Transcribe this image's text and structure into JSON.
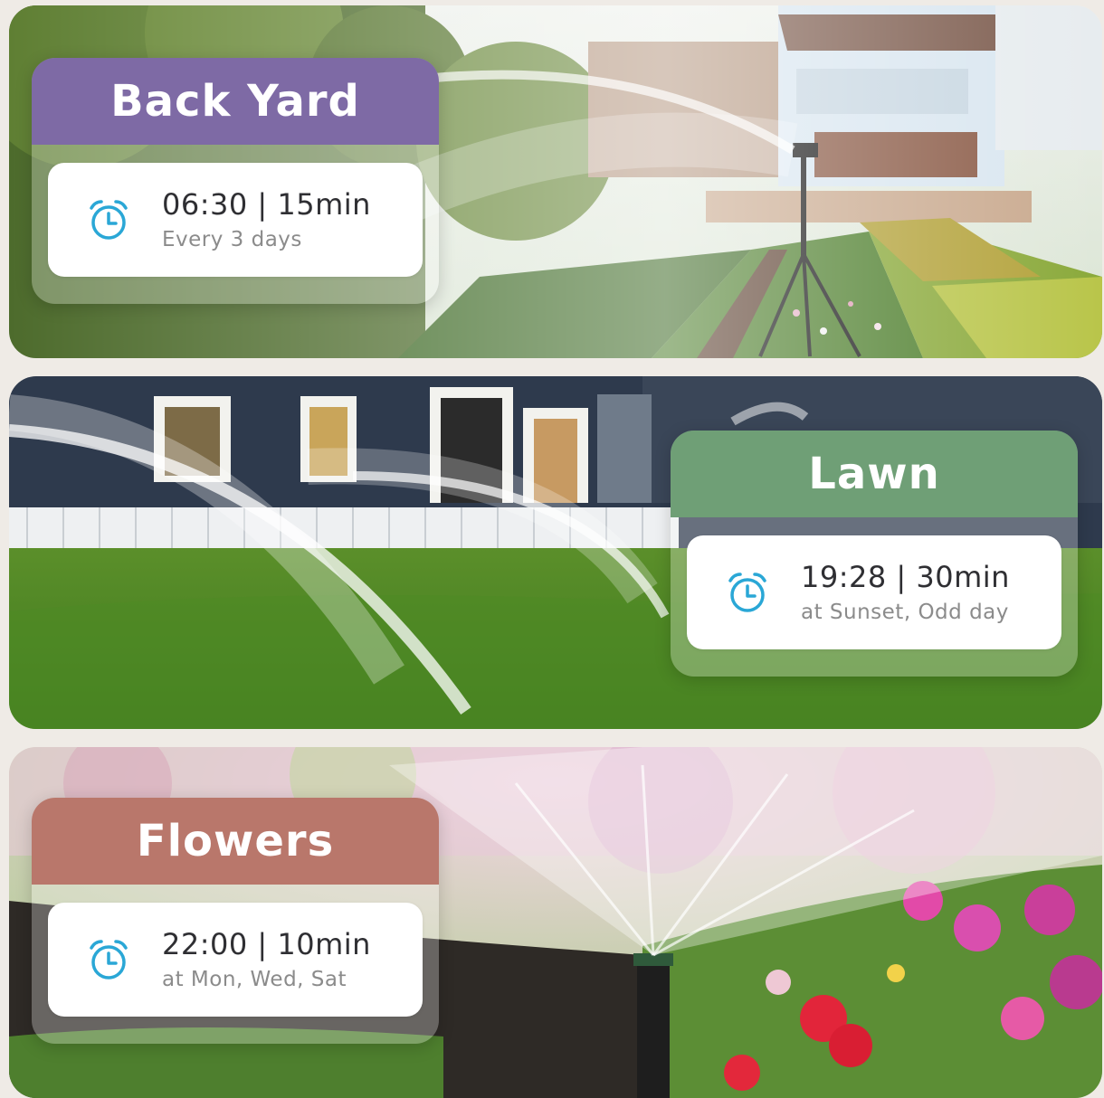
{
  "cards": [
    {
      "title": "Back Yard",
      "schedule": "06:30 | 15min",
      "frequency": "Every 3 days",
      "header_color": "#7e6aa5",
      "icon": "alarm-clock-icon"
    },
    {
      "title": "Lawn",
      "schedule": "19:28 | 30min",
      "frequency": "at Sunset, Odd day",
      "header_color": "#6f9f76",
      "icon": "alarm-clock-icon"
    },
    {
      "title": "Flowers",
      "schedule": "22:00 | 10min",
      "frequency": "at Mon, Wed, Sat",
      "header_color": "#b9776b",
      "icon": "alarm-clock-icon"
    }
  ],
  "colors": {
    "background": "#efebe6",
    "icon": "#2aa7d6"
  }
}
